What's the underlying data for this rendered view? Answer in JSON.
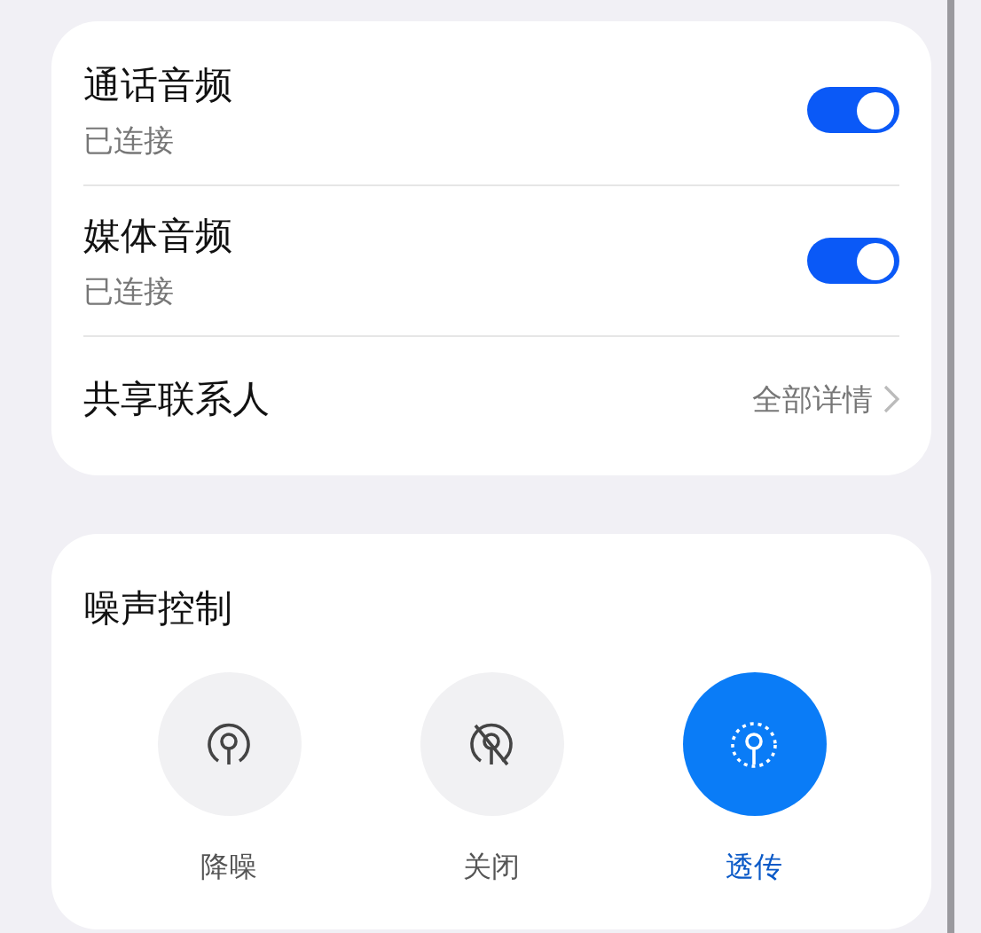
{
  "connection": {
    "items": [
      {
        "kind": "toggle",
        "title": "通话音频",
        "subtitle": "已连接",
        "on": true
      },
      {
        "kind": "toggle",
        "title": "媒体音频",
        "subtitle": "已连接",
        "on": true
      },
      {
        "kind": "link",
        "title": "共享联系人",
        "value": "全部详情"
      }
    ]
  },
  "noise_control": {
    "title": "噪声控制",
    "modes": [
      {
        "kind": "anc",
        "label": "降噪",
        "selected": false
      },
      {
        "kind": "off",
        "label": "关闭",
        "selected": false
      },
      {
        "kind": "aware",
        "label": "透传",
        "selected": true
      }
    ]
  }
}
